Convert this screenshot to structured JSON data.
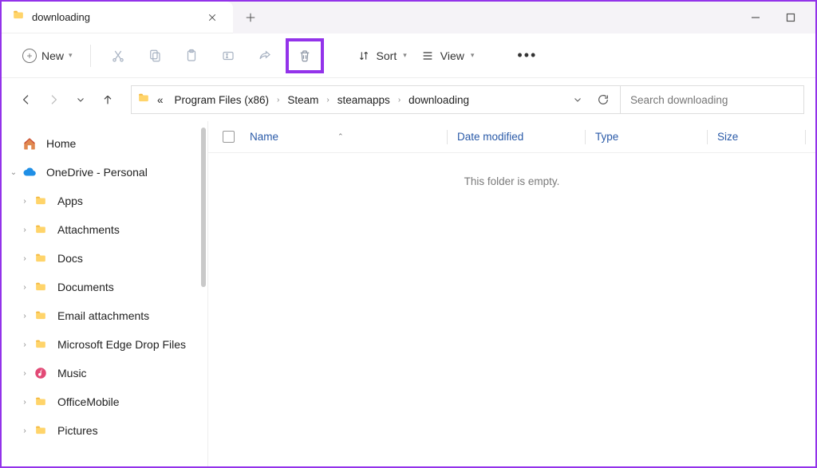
{
  "tab": {
    "title": "downloading"
  },
  "toolbar": {
    "new_label": "New",
    "sort_label": "Sort",
    "view_label": "View"
  },
  "breadcrumb": {
    "items": [
      "Program Files (x86)",
      "Steam",
      "steamapps",
      "downloading"
    ],
    "overflow_prefix": "«"
  },
  "search": {
    "placeholder": "Search downloading"
  },
  "nav": {
    "home": "Home",
    "onedrive": "OneDrive - Personal",
    "subs": [
      "Apps",
      "Attachments",
      "Docs",
      "Documents",
      "Email attachments",
      "Microsoft Edge Drop Files",
      "Music",
      "OfficeMobile",
      "Pictures"
    ]
  },
  "columns": {
    "name": "Name",
    "date": "Date modified",
    "type": "Type",
    "size": "Size"
  },
  "empty_text": "This folder is empty."
}
